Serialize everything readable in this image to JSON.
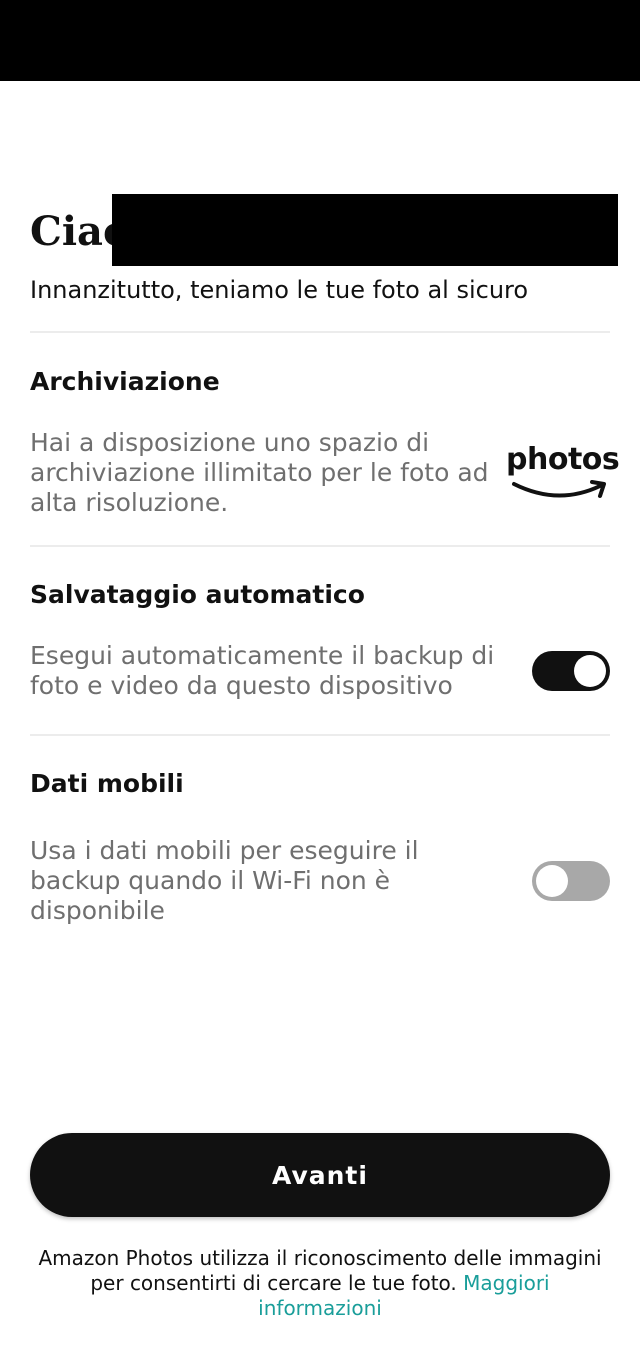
{
  "header": {
    "greeting": "Ciao",
    "subtitle": "Innanzitutto, teniamo le tue foto al sicuro"
  },
  "sections": [
    {
      "title": "Archiviazione",
      "description": "Hai a disposizione uno spazio di archiviazione illimitato per le foto ad alta risoluzione.",
      "logo_text": "photos"
    },
    {
      "title": "Salvataggio automatico",
      "description": "Esegui automaticamente il backup di foto e video da questo dispositivo",
      "toggle_on": true
    },
    {
      "title": "Dati mobili",
      "description": "Usa i dati mobili per eseguire il backup quando il Wi-Fi non è disponibile",
      "toggle_on": false
    }
  ],
  "button": {
    "label": "Avanti"
  },
  "footer": {
    "text": "Amazon Photos utilizza il riconoscimento delle immagini per consentirti di cercare le tue foto.",
    "link_text": "Maggiori informazioni"
  },
  "colors": {
    "primary": "#111111",
    "link": "#1a9e9a",
    "muted_text": "#6f6f6f",
    "toggle_off": "#a8a8a8",
    "logo_smile": "#111111"
  }
}
